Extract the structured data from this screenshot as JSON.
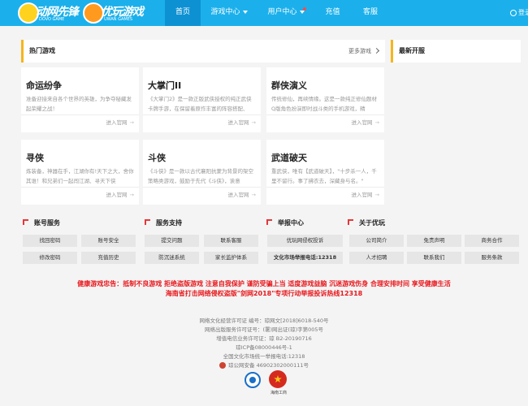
{
  "header": {
    "logo1": {
      "text": "动网先锋",
      "subtext": "DOVO GAME"
    },
    "logo2": {
      "text": "优玩游戏",
      "subtext": "UWAN GAMES"
    },
    "nav": [
      {
        "label": "首页",
        "active": true
      },
      {
        "label": "游戏中心",
        "active": false,
        "dropdown": true
      },
      {
        "label": "用户中心",
        "active": false,
        "dropdown": true,
        "dot": true
      },
      {
        "label": "充值",
        "active": false
      },
      {
        "label": "客服",
        "active": false
      }
    ],
    "login_label": "登录"
  },
  "hot_games": {
    "title": "热门游戏",
    "more_label": "更多游戏",
    "games": [
      {
        "name": "命运纷争",
        "desc": "准备迎接来自各个世界的英雄，为争夺秘藏发起荣耀之战！",
        "link": "进入官网"
      },
      {
        "name": "大掌门II",
        "desc": "《大掌门2》是一款正版武侠授权的纯正武侠卡牌手游，在保留着原作丰富的阵容搭配、",
        "link": "进入官网"
      },
      {
        "name": "群侠演义",
        "desc": "传统修仙，再续情缘。这是一款纯正修仙题材Q版角色扮演即时战斗类的手机游戏，精",
        "link": "进入官网"
      },
      {
        "name": "寻侠",
        "desc": "炼装备，神器在手，江湖你有!天下之大，舍你其谁！和兄弟们一起闯江湖、寻天下侠",
        "link": "进入官网"
      },
      {
        "name": "斗侠",
        "desc": "《斗侠》是一款以古代襄阳抗蒙为背景的架空策略类游戏，鼓励于先代《斗侠》，诶意",
        "link": "进入官网"
      },
      {
        "name": "武道破天",
        "desc": "重武侠，唯有【武道破天】，\"十步杀一人，千里不留行。事了拂衣去，深藏身与名。\"",
        "link": "进入官网"
      }
    ]
  },
  "new_servers": {
    "title": "最新开服"
  },
  "services": [
    {
      "title": "账号服务",
      "buttons": [
        "找回密码",
        "账号安全",
        "修改密码",
        "充值历史"
      ]
    },
    {
      "title": "服务支持",
      "buttons": [
        "提交问题",
        "联系客服",
        "防沉迷系统",
        "家长监护体系"
      ]
    },
    {
      "title": "举报中心",
      "buttons": [
        "优玩网侵权投诉",
        "文化市场举报电话:12318"
      ]
    },
    {
      "title": "关于优玩",
      "buttons": [
        "公司简介",
        "免责声明",
        "商务合作",
        "人才招聘",
        "联系我们",
        "服务条款"
      ]
    }
  ],
  "notice": {
    "line1": "健康游戏忠告：抵制不良游戏 拒绝盗版游戏 注意自我保护 谨防受骗上当 适度游戏益脑 沉迷游戏伤身 合理安排时间 享受健康生活",
    "line2": "海南省打击网络侵权盗版\"剑网2018\"专项行动举报投诉热线12318"
  },
  "footer": {
    "lines": [
      "网络文化经营许可证 编号：琼网文[2018]6018-540号",
      "网络出版服务许可证号：(署)网出证(琼)字第005号",
      "增值电信业务许可证：琼 B2-20190716",
      "琼ICP备08000446号-1",
      "全国文化市场统一举报电话:12318"
    ],
    "police_record": "琼公网安备 46902302000111号",
    "badge2_label": "海南工商"
  },
  "colors": {
    "topbar": "#1bb0eb",
    "nav_active": "#0d91d2",
    "accent": "#f5b51c",
    "notice_red": "#e8171c"
  }
}
